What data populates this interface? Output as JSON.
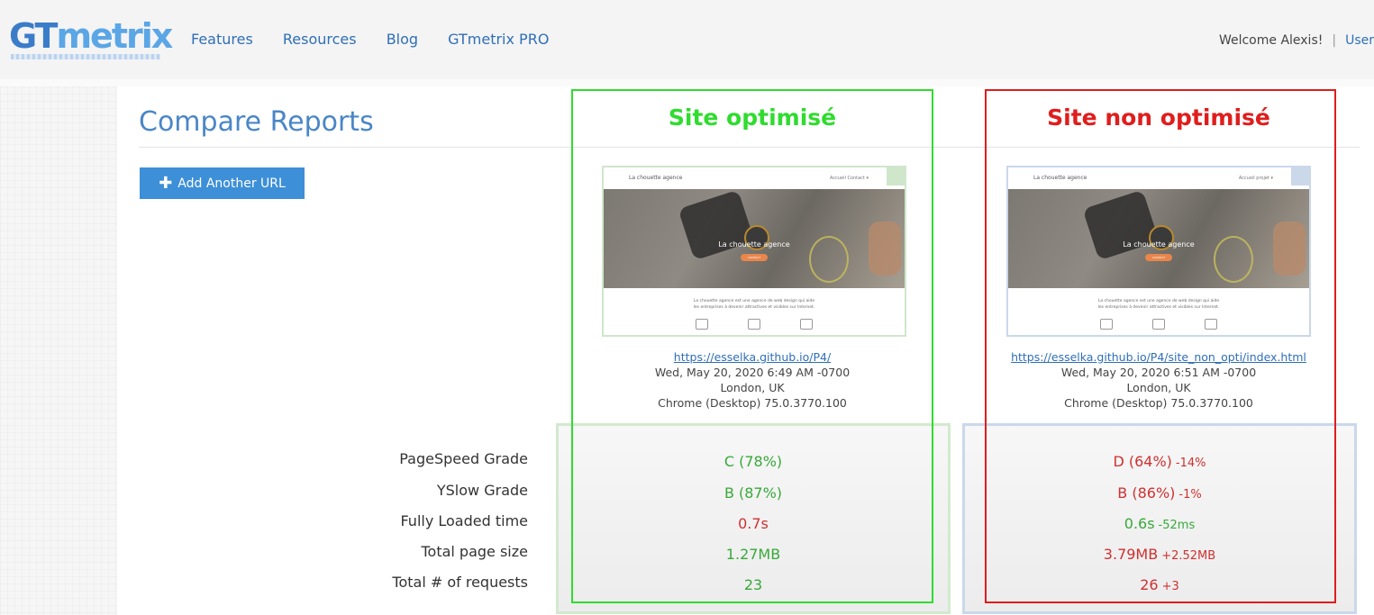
{
  "header": {
    "logo_gt": "GT",
    "logo_metrix": "metrix",
    "nav": [
      "Features",
      "Resources",
      "Blog",
      "GTmetrix PRO"
    ],
    "welcome": "Welcome Alexis!",
    "separator": "|",
    "user_link": "User"
  },
  "page": {
    "title": "Compare Reports",
    "add_button": "Add Another URL"
  },
  "metric_labels": [
    "PageSpeed Grade",
    "YSlow Grade",
    "Fully Loaded time",
    "Total page size",
    "Total # of requests"
  ],
  "sites": [
    {
      "annotation": "Site optimisé",
      "annotation_color": "#2fdc2f",
      "thumb": {
        "logo": "La chouette agence",
        "links": "Accueil   Contact ▾",
        "hero_title": "La chouette agence",
        "hero_button": "CONTACT",
        "desc1": "La chouette agence est une agence de web design qui aide",
        "desc2": "les entreprises à devenir attractives et visibles sur Internet."
      },
      "url": "https://esselka.github.io/P4/",
      "date": "Wed, May 20, 2020 6:49 AM -0700",
      "location": "London, UK",
      "browser": "Chrome (Desktop) 75.0.3770.100",
      "metrics": [
        {
          "value": "C (78%)",
          "delta": "",
          "status": "good"
        },
        {
          "value": "B (87%)",
          "delta": "",
          "status": "good"
        },
        {
          "value": "0.7s",
          "delta": "",
          "status": "bad"
        },
        {
          "value": "1.27MB",
          "delta": "",
          "status": "good"
        },
        {
          "value": "23",
          "delta": "",
          "status": "good"
        }
      ]
    },
    {
      "annotation": "Site non optimisé",
      "annotation_color": "#e01d1d",
      "thumb": {
        "logo": "La chouette agence",
        "links": "Accueil   projet ▾",
        "hero_title": "La chouette agence",
        "hero_button": "CONTACT",
        "desc1": "La chouette agence est une agence de web design qui aide",
        "desc2": "les entreprises à devenir attractives et visibles sur Internet."
      },
      "url": "https://esselka.github.io/P4/site_non_opti/index.html",
      "date": "Wed, May 20, 2020 6:51 AM -0700",
      "location": "London, UK",
      "browser": "Chrome (Desktop) 75.0.3770.100",
      "metrics": [
        {
          "value": "D (64%)",
          "delta": "-14%",
          "status": "bad"
        },
        {
          "value": "B (86%)",
          "delta": "-1%",
          "status": "bad"
        },
        {
          "value": "0.6s",
          "delta": "-52ms",
          "status": "good"
        },
        {
          "value": "3.79MB",
          "delta": "+2.52MB",
          "status": "bad"
        },
        {
          "value": "26",
          "delta": "+3",
          "status": "bad"
        }
      ]
    }
  ],
  "colors": {
    "brand": "#3b7cc9",
    "good": "#38a93a",
    "bad": "#cf3131",
    "box_green": "#d3e9cf",
    "box_blue": "#cad8ea",
    "button": "#3d8fd8"
  }
}
